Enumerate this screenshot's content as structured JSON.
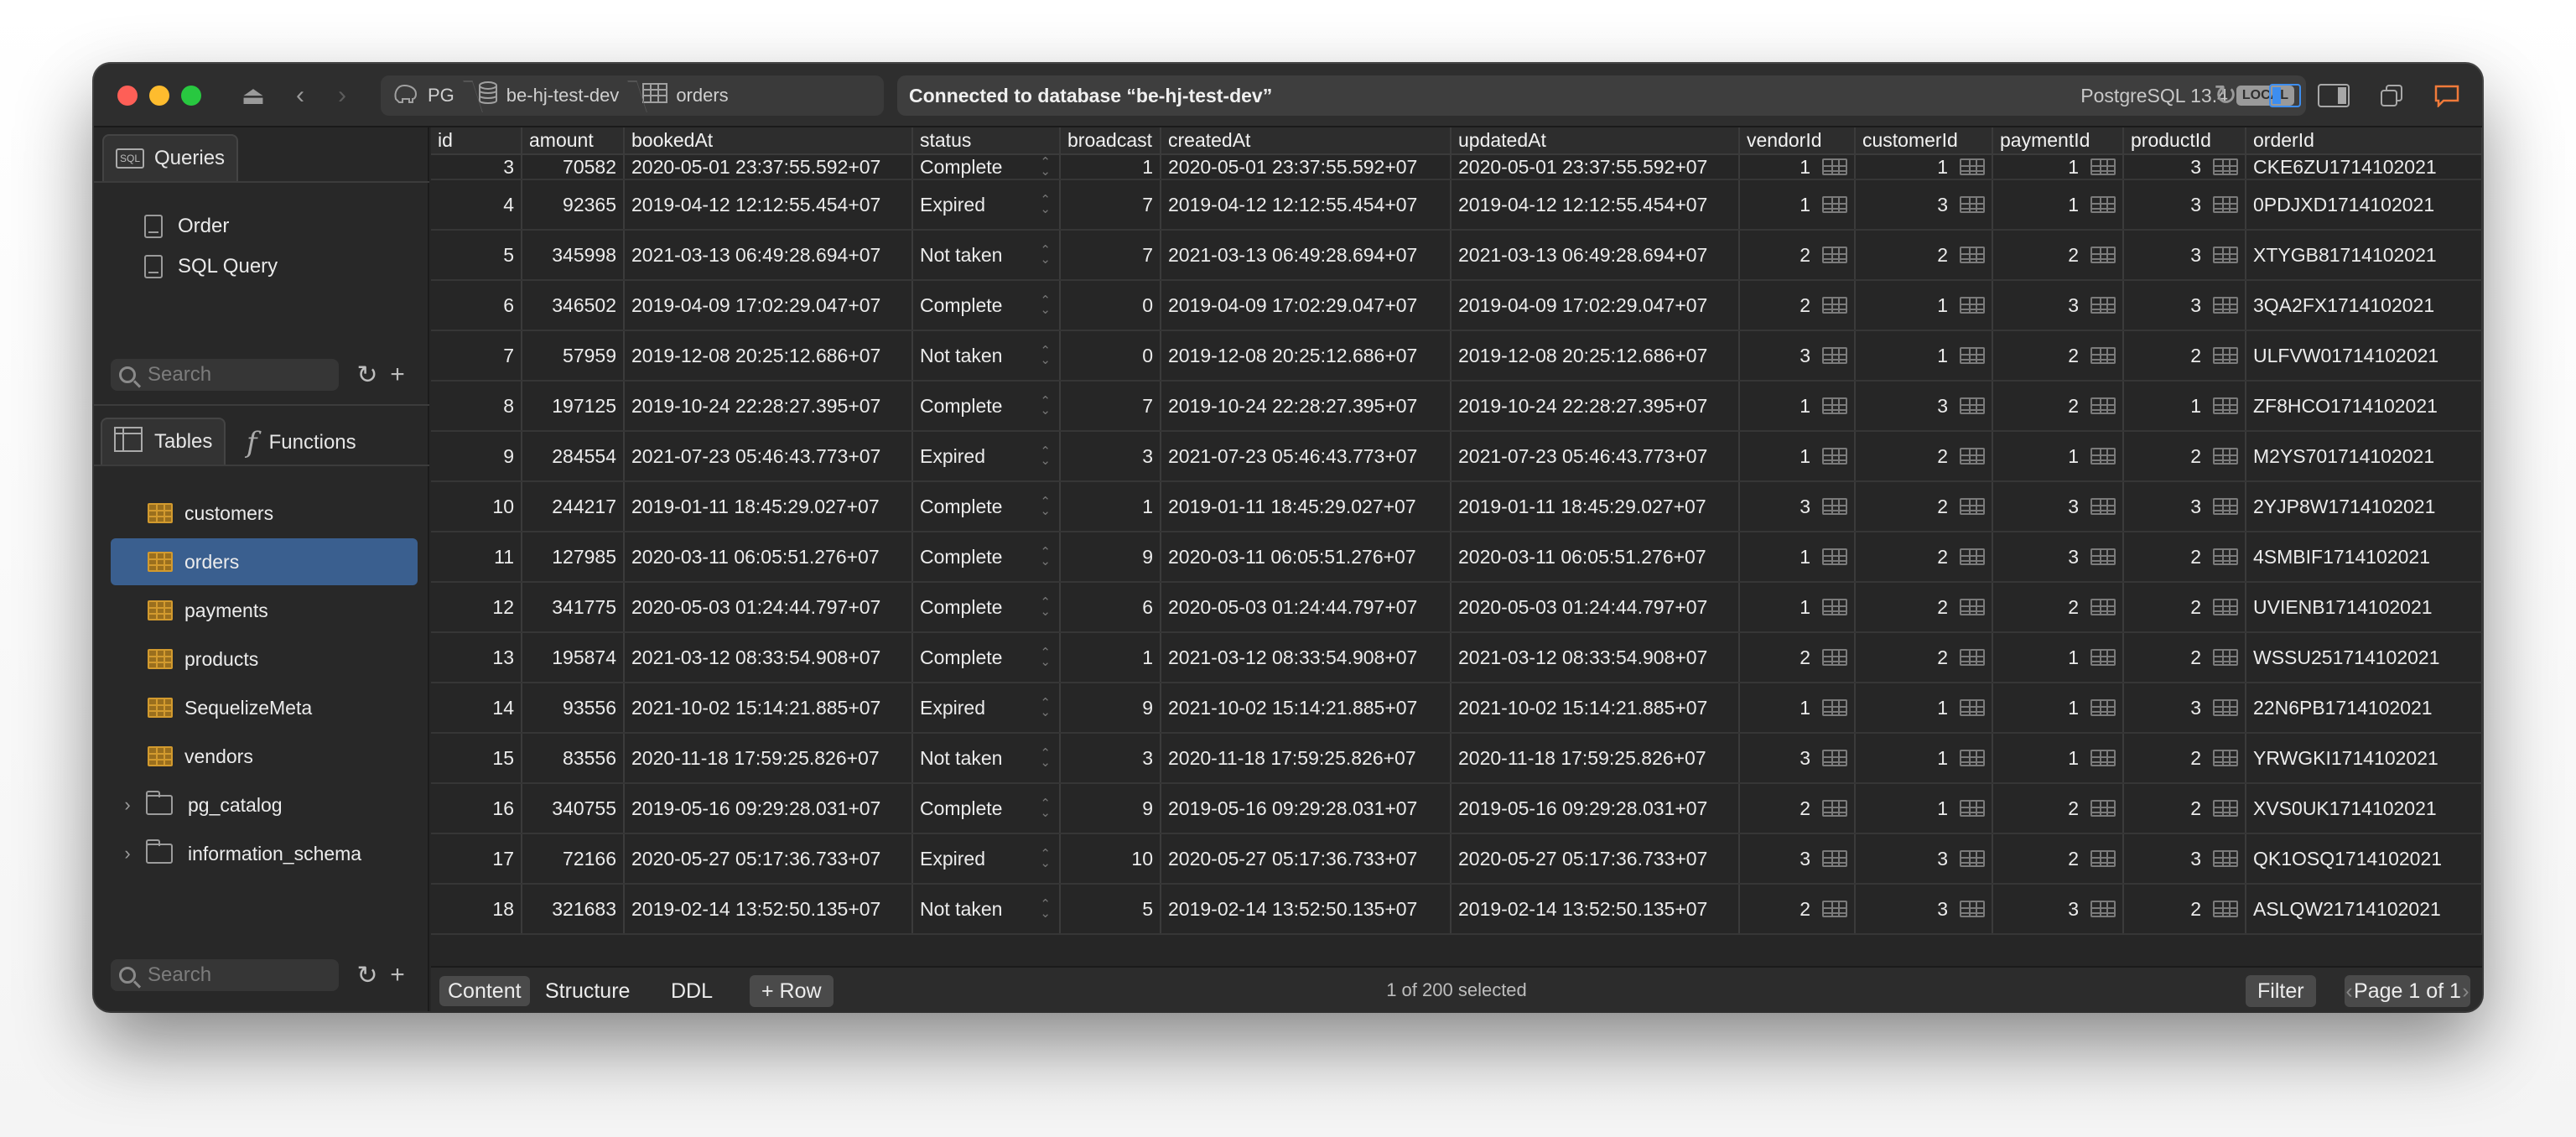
{
  "breadcrumb": {
    "server": "PG",
    "database": "be-hj-test-dev",
    "table": "orders"
  },
  "connection": {
    "message": "Connected to database “be-hj-test-dev”",
    "version": "PostgreSQL 13.4",
    "badge": "LOCAL"
  },
  "sidebar": {
    "queries_tab": "Queries",
    "queries": [
      "Order",
      "SQL Query"
    ],
    "search_placeholder": "Search",
    "tables_tab": "Tables",
    "functions_tab": "Functions",
    "tables": [
      "customers",
      "orders",
      "payments",
      "products",
      "SequelizeMeta",
      "vendors"
    ],
    "selected_table": "orders",
    "schemas": [
      "pg_catalog",
      "information_schema"
    ]
  },
  "grid": {
    "columns": [
      "id",
      "amount",
      "bookedAt",
      "status",
      "broadcast",
      "createdAt",
      "updatedAt",
      "vendorId",
      "customerId",
      "paymentId",
      "productId",
      "orderId"
    ],
    "rows": [
      [
        "3",
        "70582",
        "2020-05-01 23:37:55.592+07",
        "Complete",
        "1",
        "2020-05-01 23:37:55.592+07",
        "2020-05-01 23:37:55.592+07",
        "1",
        "1",
        "1",
        "3",
        "CKE6ZU1714102021"
      ],
      [
        "4",
        "92365",
        "2019-04-12 12:12:55.454+07",
        "Expired",
        "7",
        "2019-04-12 12:12:55.454+07",
        "2019-04-12 12:12:55.454+07",
        "1",
        "3",
        "1",
        "3",
        "0PDJXD1714102021"
      ],
      [
        "5",
        "345998",
        "2021-03-13 06:49:28.694+07",
        "Not taken",
        "7",
        "2021-03-13 06:49:28.694+07",
        "2021-03-13 06:49:28.694+07",
        "2",
        "2",
        "2",
        "3",
        "XTYGB81714102021"
      ],
      [
        "6",
        "346502",
        "2019-04-09 17:02:29.047+07",
        "Complete",
        "0",
        "2019-04-09 17:02:29.047+07",
        "2019-04-09 17:02:29.047+07",
        "2",
        "1",
        "3",
        "3",
        "3QA2FX1714102021"
      ],
      [
        "7",
        "57959",
        "2019-12-08 20:25:12.686+07",
        "Not taken",
        "0",
        "2019-12-08 20:25:12.686+07",
        "2019-12-08 20:25:12.686+07",
        "3",
        "1",
        "2",
        "2",
        "ULFVW01714102021"
      ],
      [
        "8",
        "197125",
        "2019-10-24 22:28:27.395+07",
        "Complete",
        "7",
        "2019-10-24 22:28:27.395+07",
        "2019-10-24 22:28:27.395+07",
        "1",
        "3",
        "2",
        "1",
        "ZF8HCO1714102021"
      ],
      [
        "9",
        "284554",
        "2021-07-23 05:46:43.773+07",
        "Expired",
        "3",
        "2021-07-23 05:46:43.773+07",
        "2021-07-23 05:46:43.773+07",
        "1",
        "2",
        "1",
        "2",
        "M2YS701714102021"
      ],
      [
        "10",
        "244217",
        "2019-01-11 18:45:29.027+07",
        "Complete",
        "1",
        "2019-01-11 18:45:29.027+07",
        "2019-01-11 18:45:29.027+07",
        "3",
        "2",
        "3",
        "3",
        "2YJP8W1714102021"
      ],
      [
        "11",
        "127985",
        "2020-03-11 06:05:51.276+07",
        "Complete",
        "9",
        "2020-03-11 06:05:51.276+07",
        "2020-03-11 06:05:51.276+07",
        "1",
        "2",
        "3",
        "2",
        "4SMBIF1714102021"
      ],
      [
        "12",
        "341775",
        "2020-05-03 01:24:44.797+07",
        "Complete",
        "6",
        "2020-05-03 01:24:44.797+07",
        "2020-05-03 01:24:44.797+07",
        "1",
        "2",
        "2",
        "2",
        "UVIENB1714102021"
      ],
      [
        "13",
        "195874",
        "2021-03-12 08:33:54.908+07",
        "Complete",
        "1",
        "2021-03-12 08:33:54.908+07",
        "2021-03-12 08:33:54.908+07",
        "2",
        "2",
        "1",
        "2",
        "WSSU251714102021"
      ],
      [
        "14",
        "93556",
        "2021-10-02 15:14:21.885+07",
        "Expired",
        "9",
        "2021-10-02 15:14:21.885+07",
        "2021-10-02 15:14:21.885+07",
        "1",
        "1",
        "1",
        "3",
        "22N6PB1714102021"
      ],
      [
        "15",
        "83556",
        "2020-11-18 17:59:25.826+07",
        "Not taken",
        "3",
        "2020-11-18 17:59:25.826+07",
        "2020-11-18 17:59:25.826+07",
        "3",
        "1",
        "1",
        "2",
        "YRWGKI1714102021"
      ],
      [
        "16",
        "340755",
        "2019-05-16 09:29:28.031+07",
        "Complete",
        "9",
        "2019-05-16 09:29:28.031+07",
        "2019-05-16 09:29:28.031+07",
        "2",
        "1",
        "2",
        "2",
        "XVS0UK1714102021"
      ],
      [
        "17",
        "72166",
        "2020-05-27 05:17:36.733+07",
        "Expired",
        "10",
        "2020-05-27 05:17:36.733+07",
        "2020-05-27 05:17:36.733+07",
        "3",
        "3",
        "2",
        "3",
        "QK1OSQ1714102021"
      ],
      [
        "18",
        "321683",
        "2019-02-14 13:52:50.135+07",
        "Not taken",
        "5",
        "2019-02-14 13:52:50.135+07",
        "2019-02-14 13:52:50.135+07",
        "2",
        "3",
        "3",
        "2",
        "ASLQW21714102021"
      ]
    ]
  },
  "bottombar": {
    "tabs": [
      "Content",
      "Structure",
      "DDL"
    ],
    "active_tab": "Content",
    "add_row": "+ Row",
    "selection": "1 of 200 selected",
    "filter": "Filter",
    "page": "Page 1 of 1"
  },
  "colors": {
    "window_bg": "#262626",
    "selection": "#3a5f8f",
    "table_icon": "#d29a2e",
    "close": "#fe5f57",
    "minimize": "#febc2e",
    "zoom": "#28c840"
  }
}
